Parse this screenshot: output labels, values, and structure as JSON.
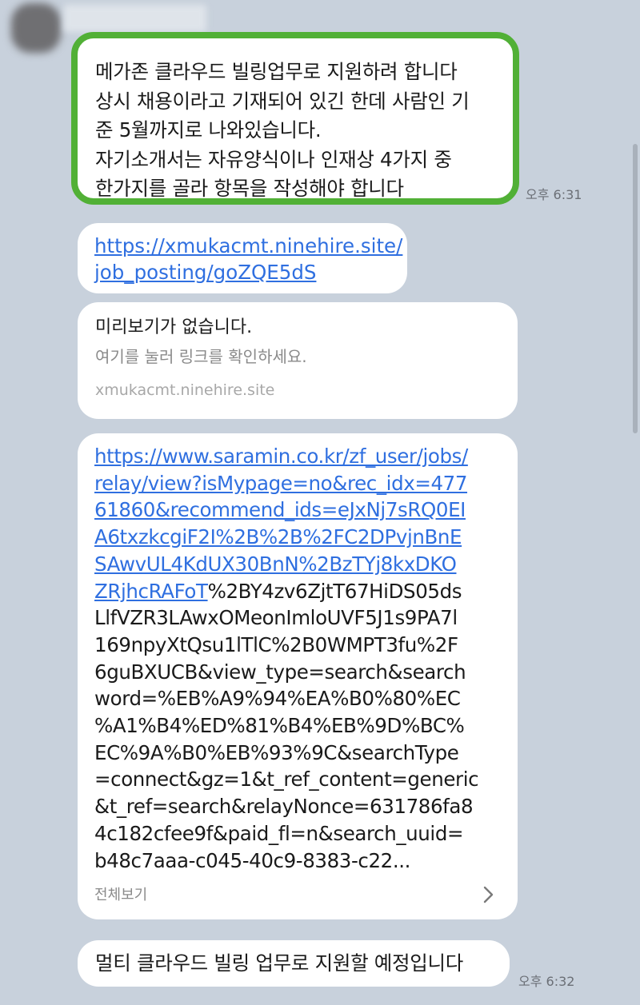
{
  "chat": {
    "sender": {
      "avatar_icon": "avatar-blurred",
      "name": ""
    },
    "highlight_color": "#51b036",
    "messages": {
      "first": {
        "lines": [
          "메가존 클라우드 빌링업무로 지원하려 합니다",
          "상시 채용이라고 기재되어 있긴 한데 사람인 기",
          "준 5월까지로 나와있습니다.",
          "자기소개서는 자유양식이나 인재상 4가지 중",
          "한가지를 골라 항목을 작성해야 합니다"
        ],
        "time": "오후 6:31"
      },
      "link1": {
        "lines": [
          "https://xmukacmt.ninehire.site/",
          "job_posting/goZQE5dS"
        ]
      },
      "preview": {
        "title": "미리보기가 없습니다.",
        "subtitle": "여기를 눌러 링크를 확인하세요.",
        "domain": "xmukacmt.ninehire.site"
      },
      "long_link": {
        "link_lines": [
          "https://www.saramin.co.kr/zf_user/jobs/",
          "relay/view?isMypage=no&rec_idx=477",
          "61860&recommend_ids=eJxNj7sRQ0EI",
          "A6txzkcgiF2I%2B%2B%2FC2DPvjnBnE",
          "SAwvUL4KdUX30BnN%2BzTYj8kxDKO"
        ],
        "mixed_link_part": "ZRjhcRAFoT",
        "mixed_text_part": "%2BY4zv6ZjtT67HiDS05ds",
        "text_lines": [
          "LlfVZR3LAwxOMeonImloUVF5J1s9PA7l",
          "169npyXtQsu1lTlC%2B0WMPT3fu%2F",
          "6guBXUCB&view_type=search&search",
          "word=%EB%A9%94%EA%B0%80%EC",
          "%A1%B4%ED%81%B4%EB%9D%BC%",
          "EC%9A%B0%EB%93%9C&searchType",
          "=connect&gz=1&t_ref_content=generic",
          "&t_ref=search&relayNonce=631786fa8",
          "4c182cfee9f&paid_fl=n&search_uuid=",
          "b48c7aaa-c045-40c9-8383-c22..."
        ],
        "view_all": "전체보기",
        "chevron_icon": "chevron-right-icon"
      },
      "last": {
        "text": "멀티 클라우드 빌링 업무로 지원할 예정입니다",
        "time": "오후 6:32"
      }
    }
  }
}
